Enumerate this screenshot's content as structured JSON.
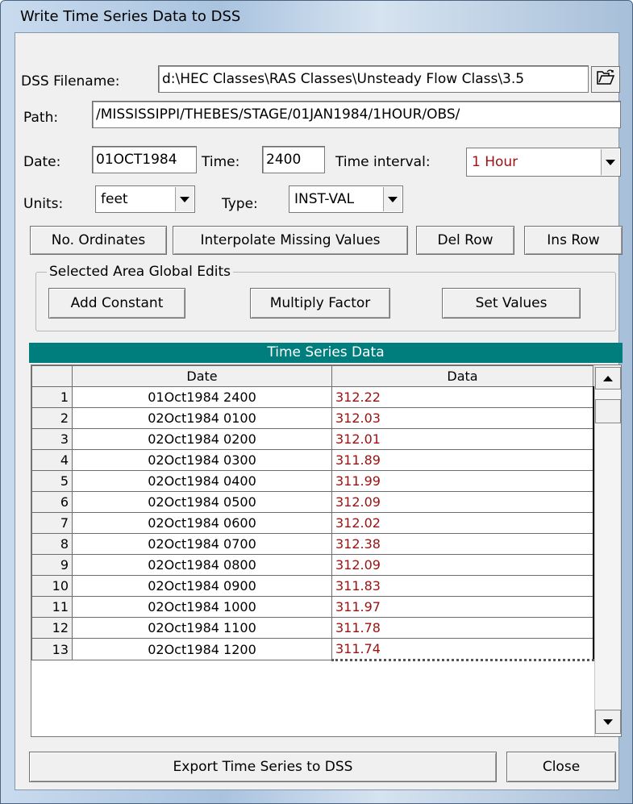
{
  "window": {
    "title": "Write Time Series Data to DSS"
  },
  "dss": {
    "label": "DSS Filename:",
    "value": "d:\\HEC Classes\\RAS Classes\\Unsteady Flow Class\\3.5"
  },
  "path": {
    "label": "Path:",
    "value": "/MISSISSIPPI/THEBES/STAGE/01JAN1984/1HOUR/OBS/"
  },
  "date": {
    "label": "Date:",
    "value": "01OCT1984"
  },
  "time": {
    "label": "Time:",
    "value": "2400"
  },
  "interval": {
    "label": "Time interval:",
    "value": "1 Hour",
    "color": "#9b1010"
  },
  "units": {
    "label": "Units:",
    "value": "feet"
  },
  "type": {
    "label": "Type:",
    "value": "INST-VAL"
  },
  "buttons": {
    "no_ordinates": "No. Ordinates",
    "interpolate": "Interpolate Missing Values",
    "del_row": "Del Row",
    "ins_row": "Ins Row",
    "export": "Export Time Series to DSS",
    "close": "Close"
  },
  "global_edits": {
    "label": "Selected Area Global Edits",
    "add_constant": "Add Constant",
    "multiply_factor": "Multiply Factor",
    "set_values": "Set Values"
  },
  "table": {
    "title": "Time Series Data",
    "header_color": "#007d7d",
    "columns": [
      "",
      "Date",
      "Data"
    ],
    "rows": [
      {
        "n": "1",
        "date": "01Oct1984 2400",
        "data": "312.22"
      },
      {
        "n": "2",
        "date": "02Oct1984 0100",
        "data": "312.03"
      },
      {
        "n": "3",
        "date": "02Oct1984 0200",
        "data": "312.01"
      },
      {
        "n": "4",
        "date": "02Oct1984 0300",
        "data": "311.89"
      },
      {
        "n": "5",
        "date": "02Oct1984 0400",
        "data": "311.99"
      },
      {
        "n": "6",
        "date": "02Oct1984 0500",
        "data": "312.09"
      },
      {
        "n": "7",
        "date": "02Oct1984 0600",
        "data": "312.02"
      },
      {
        "n": "8",
        "date": "02Oct1984 0700",
        "data": "312.38"
      },
      {
        "n": "9",
        "date": "02Oct1984 0800",
        "data": "312.09"
      },
      {
        "n": "10",
        "date": "02Oct1984 0900",
        "data": "311.83"
      },
      {
        "n": "11",
        "date": "02Oct1984 1000",
        "data": "311.97"
      },
      {
        "n": "12",
        "date": "02Oct1984 1100",
        "data": "311.78"
      },
      {
        "n": "13",
        "date": "02Oct1984 1200",
        "data": "311.74"
      }
    ]
  },
  "icons": {
    "open_folder": "open-folder-icon",
    "scroll_up": "arrow-up-icon",
    "scroll_down": "arrow-down-icon",
    "dropdown": "chevron-down-icon"
  }
}
